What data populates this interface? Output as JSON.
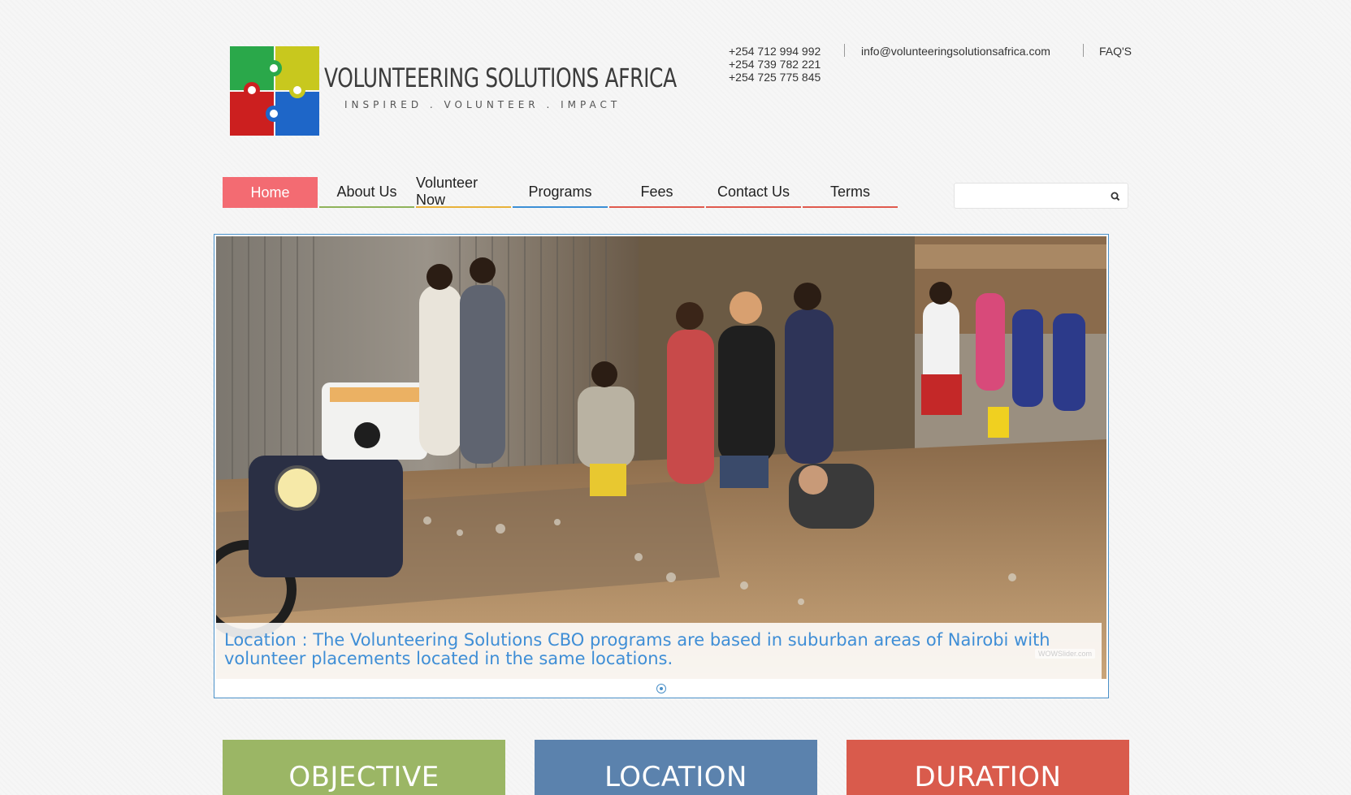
{
  "brand": {
    "title": "VOLUNTEERING SOLUTIONS AFRICA",
    "tagline": "INSPIRED . VOLUNTEER . IMPACT",
    "puzzle_colors": [
      "#2aa84a",
      "#c8c81e",
      "#cc1f1f",
      "#1e66c8"
    ]
  },
  "contact": {
    "phones": [
      "+254 712 994 992",
      "+254 739 782 221",
      "+254 725 775 845"
    ],
    "email": "info@volunteeringsolutionsafrica.com",
    "faq_label": "FAQ'S"
  },
  "nav": {
    "items": [
      {
        "label": "Home",
        "color": "#f36b72",
        "active": true
      },
      {
        "label": "About Us",
        "color": "#8fb35a",
        "active": false
      },
      {
        "label": "Volunteer Now",
        "color": "#e8b23a",
        "active": false
      },
      {
        "label": "Programs",
        "color": "#3c8fd6",
        "active": false
      },
      {
        "label": "Fees",
        "color": "#e05a4e",
        "active": false
      },
      {
        "label": "Contact Us",
        "color": "#e05a4e",
        "active": false
      },
      {
        "label": "Terms",
        "color": "#e05a4e",
        "active": false
      }
    ]
  },
  "search": {
    "placeholder": "",
    "icon": "search-icon"
  },
  "slider": {
    "caption": "Location : The Volunteering Solutions CBO programs are based in suburban areas of Nairobi with volunteer placements located in the same locations.",
    "watermark": "WOWSlider.com",
    "image_alt": "Volunteers with a camera crew in a busy street market in Nairobi",
    "accent": "#4a90c8"
  },
  "tiles": [
    {
      "label": "OBJECTIVE",
      "color": "#9bb665"
    },
    {
      "label": "LOCATION",
      "color": "#5b82ad"
    },
    {
      "label": "DURATION",
      "color": "#d95b4c"
    }
  ]
}
